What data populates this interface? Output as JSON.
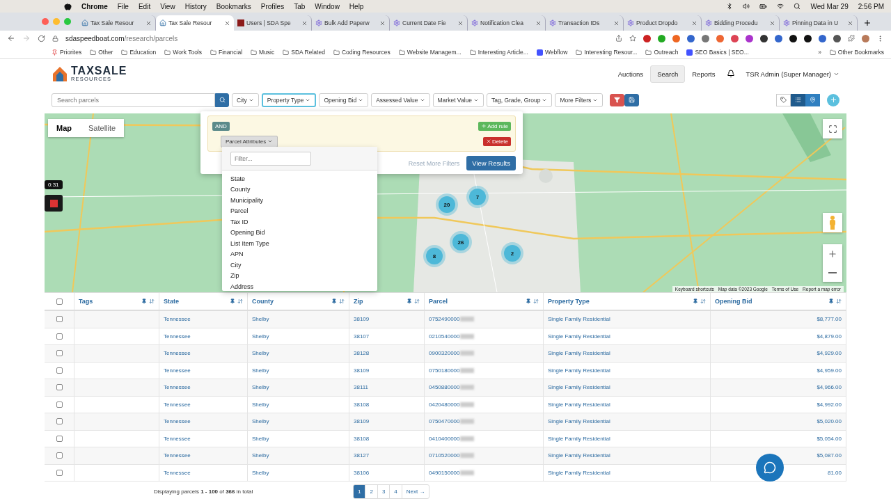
{
  "menubar": {
    "app": "Chrome",
    "menus": [
      "File",
      "Edit",
      "View",
      "History",
      "Bookmarks",
      "Profiles",
      "Tab",
      "Window",
      "Help"
    ],
    "date": "Wed Mar 29",
    "time": "2:56 PM"
  },
  "browser": {
    "tabs": [
      {
        "title": "Tax Sale Resour",
        "kind": "house",
        "selected": false
      },
      {
        "title": "Tax Sale Resour",
        "kind": "house",
        "selected": true
      },
      {
        "title": "Users | SDA Spe",
        "kind": "square",
        "selected": false
      },
      {
        "title": "Bulk Add Paperw",
        "kind": "gear",
        "selected": false
      },
      {
        "title": "Current Date Fie",
        "kind": "gear",
        "selected": false
      },
      {
        "title": "Notification Clea",
        "kind": "gear",
        "selected": false
      },
      {
        "title": "Transaction IDs",
        "kind": "gear",
        "selected": false
      },
      {
        "title": "Product Dropdo",
        "kind": "gear",
        "selected": false
      },
      {
        "title": "Bidding Procedu",
        "kind": "gear",
        "selected": false
      },
      {
        "title": "Pinning Data in U",
        "kind": "gear",
        "selected": false
      }
    ],
    "url_domain": "sdaspeedboat.com",
    "url_path": "/research/parcels",
    "bookmarks": [
      {
        "label": "Priorites",
        "kind": "pin"
      },
      {
        "label": "Other",
        "kind": "folder"
      },
      {
        "label": "Education",
        "kind": "folder"
      },
      {
        "label": "Work Tools",
        "kind": "folder"
      },
      {
        "label": "Financial",
        "kind": "folder"
      },
      {
        "label": "Music",
        "kind": "folder"
      },
      {
        "label": "SDA Related",
        "kind": "folder"
      },
      {
        "label": "Coding Resources",
        "kind": "folder"
      },
      {
        "label": "Website Managem...",
        "kind": "folder"
      },
      {
        "label": "Interesting Article...",
        "kind": "folder"
      },
      {
        "label": "Webflow",
        "kind": "site"
      },
      {
        "label": "Interesting Resour...",
        "kind": "folder"
      },
      {
        "label": "Outreach",
        "kind": "folder"
      },
      {
        "label": "SEO Basics | SEO...",
        "kind": "site"
      }
    ],
    "more": "»",
    "other_bookmarks": "Other Bookmarks"
  },
  "app": {
    "logo_top": "TAXSALE",
    "logo_bottom": "RESOURCES",
    "nav": [
      {
        "label": "Auctions",
        "selected": false
      },
      {
        "label": "Search",
        "selected": true
      },
      {
        "label": "Reports",
        "selected": false
      }
    ],
    "user": "TSR Admin (Super Manager)"
  },
  "filters": {
    "search_placeholder": "Search parcels",
    "dropdowns": [
      {
        "label": "City",
        "selected": false
      },
      {
        "label": "Property Type",
        "selected": true
      },
      {
        "label": "Opening Bid",
        "selected": false
      },
      {
        "label": "Assessed Value",
        "selected": false
      },
      {
        "label": "Market Value",
        "selected": false
      },
      {
        "label": "Tag, Grade, Group",
        "selected": false
      },
      {
        "label": "More Filters",
        "selected": false
      }
    ],
    "view_buttons": [
      {
        "kind": "tag",
        "selected": false
      },
      {
        "kind": "list",
        "selected": true
      },
      {
        "kind": "pin",
        "selected": false
      }
    ]
  },
  "map": {
    "types": [
      {
        "label": "Map",
        "selected": true
      },
      {
        "label": "Satellite",
        "selected": false
      }
    ],
    "clusters": [
      "20",
      "7",
      "26",
      "8",
      "2"
    ],
    "attribution": [
      "Keyboard shortcuts",
      "Map data ©2023 Google",
      "Terms of Use",
      "Report a map error"
    ]
  },
  "recording": {
    "time": "0:31"
  },
  "filter_popup": {
    "operator": "AND",
    "add_rule": "Add rule",
    "delete": "Delete",
    "attribute_button": "Parcel Attributes",
    "filter_placeholder": "Filter...",
    "attributes": [
      "State",
      "County",
      "Municipality",
      "Parcel",
      "Tax ID",
      "Opening Bid",
      "List Item Type",
      "APN",
      "City",
      "Zip",
      "Address"
    ],
    "reset": "Reset More Filters",
    "submit": "View Results"
  },
  "table": {
    "columns": [
      "Tags",
      "State",
      "County",
      "Zip",
      "Parcel",
      "Property Type",
      "Opening Bid"
    ],
    "all_checked": false,
    "rows": [
      {
        "checked": false,
        "state": "Tennessee",
        "county": "Shelby",
        "zip": "38109",
        "parcel": "0752490000",
        "property_type": "Single Family Residential",
        "opening_bid": "$8,777.00"
      },
      {
        "checked": false,
        "state": "Tennessee",
        "county": "Shelby",
        "zip": "38107",
        "parcel": "0210540000",
        "property_type": "Single Family Residential",
        "opening_bid": "$4,879.00"
      },
      {
        "checked": false,
        "state": "Tennessee",
        "county": "Shelby",
        "zip": "38128",
        "parcel": "0900320000",
        "property_type": "Single Family Residential",
        "opening_bid": "$4,929.00"
      },
      {
        "checked": false,
        "state": "Tennessee",
        "county": "Shelby",
        "zip": "38109",
        "parcel": "0750180000",
        "property_type": "Single Family Residential",
        "opening_bid": "$4,959.00"
      },
      {
        "checked": false,
        "state": "Tennessee",
        "county": "Shelby",
        "zip": "38111",
        "parcel": "0450880000",
        "property_type": "Single Family Residential",
        "opening_bid": "$4,966.00"
      },
      {
        "checked": false,
        "state": "Tennessee",
        "county": "Shelby",
        "zip": "38108",
        "parcel": "0420480000",
        "property_type": "Single Family Residential",
        "opening_bid": "$4,992.00"
      },
      {
        "checked": false,
        "state": "Tennessee",
        "county": "Shelby",
        "zip": "38109",
        "parcel": "0750470000",
        "property_type": "Single Family Residential",
        "opening_bid": "$5,020.00"
      },
      {
        "checked": false,
        "state": "Tennessee",
        "county": "Shelby",
        "zip": "38108",
        "parcel": "0410400000",
        "property_type": "Single Family Residential",
        "opening_bid": "$5,054.00"
      },
      {
        "checked": false,
        "state": "Tennessee",
        "county": "Shelby",
        "zip": "38127",
        "parcel": "0710520000",
        "property_type": "Single Family Residential",
        "opening_bid": "$5,087.00"
      },
      {
        "checked": false,
        "state": "Tennessee",
        "county": "Shelby",
        "zip": "38106",
        "parcel": "0490150000",
        "property_type": "Single Family Residential",
        "opening_bid": "81.00"
      }
    ]
  },
  "footer": {
    "summary": "Displaying parcels **1 - 100** of **366** in total",
    "pages": [
      {
        "label": "1",
        "selected": true
      },
      {
        "label": "2",
        "selected": false
      },
      {
        "label": "3",
        "selected": false
      },
      {
        "label": "4",
        "selected": false
      }
    ],
    "next": "Next →"
  }
}
